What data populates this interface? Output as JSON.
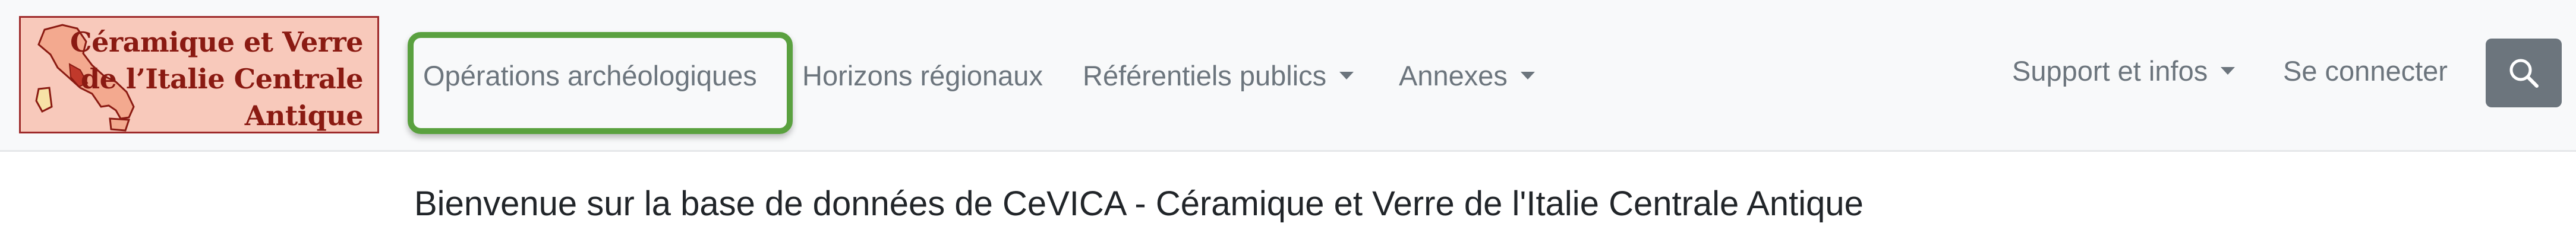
{
  "logo": {
    "line1": "Céramique et Verre",
    "line2": "de l’Italie Centrale",
    "line3": "Antique",
    "icon": "italy-map-logo",
    "colors": {
      "background": "#f8c9bb",
      "text": "#8a1a12",
      "border": "#9e2a2a"
    }
  },
  "nav": {
    "operations": "Opérations archéologiques",
    "horizons": "Horizons régionaux",
    "referentiels": "Référentiels publics",
    "annexes": "Annexes",
    "support": "Support et infos",
    "login": "Se connecter",
    "search_icon": "search-icon"
  },
  "highlight": {
    "color": "#5aa13f"
  },
  "main": {
    "welcome": "Bienvenue sur la base de données de CeVICA - Céramique et Verre de l'Italie Centrale Antique"
  }
}
